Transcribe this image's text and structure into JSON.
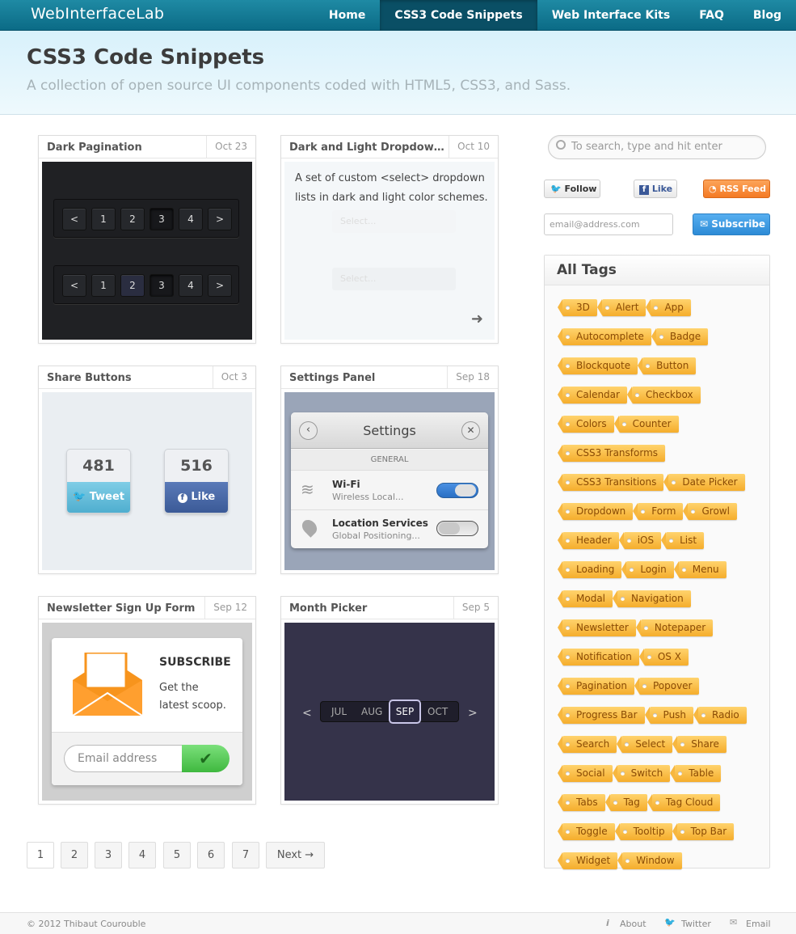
{
  "header": {
    "logo": "WebInterfaceLab",
    "nav": [
      {
        "label": "Home"
      },
      {
        "label": "CSS3 Code Snippets"
      },
      {
        "label": "Web Interface Kits"
      },
      {
        "label": "FAQ"
      },
      {
        "label": "Blog"
      }
    ]
  },
  "hero": {
    "title": "CSS3 Code Snippets",
    "subtitle": "A collection of open source UI components coded with HTML5, CSS3, and Sass."
  },
  "cards": [
    {
      "title": "Dark Pagination",
      "date": "Oct 23",
      "pages": [
        "<",
        "1",
        "2",
        "3",
        "4",
        ">"
      ]
    },
    {
      "title": "Dark and Light Dropdown Lists",
      "date": "Oct 10",
      "desc": "A set of custom <select> dropdown lists in dark and light color schemes.",
      "select_placeholder": "Select...",
      "arrow": "➜"
    },
    {
      "title": "Share Buttons",
      "date": "Oct 3",
      "tweet_count": "481",
      "tweet_label": "Tweet",
      "like_count": "516",
      "like_label": "Like"
    },
    {
      "title": "Settings Panel",
      "date": "Sep 18",
      "panel_title": "Settings",
      "section": "GENERAL",
      "rows": [
        {
          "label": "Wi-Fi",
          "sub": "Wireless Local..."
        },
        {
          "label": "Location Services",
          "sub": "Global Positioning..."
        }
      ]
    },
    {
      "title": "Newsletter Sign Up Form",
      "date": "Sep 12",
      "heading": "SUBSCRIBE",
      "text1": "Get the",
      "text2": "latest scoop.",
      "email_placeholder": "Email address"
    },
    {
      "title": "Month Picker",
      "date": "Sep 5",
      "months": [
        "JUL",
        "AUG",
        "SEP",
        "OCT"
      ],
      "prev": "<",
      "next": ">"
    }
  ],
  "sidebar": {
    "search_placeholder": "To search, type and hit enter",
    "follow": "Follow",
    "like": "Like",
    "rss": "RSS Feed",
    "email_placeholder": "email@address.com",
    "subscribe": "Subscribe",
    "tags_title": "All Tags",
    "tag_rows": [
      [
        "3D",
        "Alert",
        "App"
      ],
      [
        "Autocomplete",
        "Badge"
      ],
      [
        "Blockquote",
        "Button"
      ],
      [
        "Calendar",
        "Checkbox"
      ],
      [
        "Colors",
        "Counter"
      ],
      [
        "CSS3 Transforms"
      ],
      [
        "CSS3 Transitions",
        "Date Picker"
      ],
      [
        "Dropdown",
        "Form",
        "Growl"
      ],
      [
        "Header",
        "iOS",
        "List"
      ],
      [
        "Loading",
        "Login",
        "Menu"
      ],
      [
        "Modal",
        "Navigation"
      ],
      [
        "Newsletter",
        "Notepaper"
      ],
      [
        "Notification",
        "OS X"
      ],
      [
        "Pagination",
        "Popover"
      ],
      [
        "Progress Bar",
        "Push",
        "Radio"
      ],
      [
        "Search",
        "Select",
        "Share"
      ],
      [
        "Social",
        "Switch",
        "Table"
      ],
      [
        "Tabs",
        "Tag",
        "Tag Cloud"
      ],
      [
        "Toggle",
        "Tooltip",
        "Top Bar"
      ],
      [
        "Widget",
        "Window"
      ]
    ]
  },
  "pagination": {
    "pages": [
      "1",
      "2",
      "3",
      "4",
      "5",
      "6",
      "7"
    ],
    "next": "Next →"
  },
  "footer": {
    "copyright": "© 2012 Thibaut Courouble",
    "about": "About",
    "twitter": "Twitter",
    "email": "Email"
  }
}
